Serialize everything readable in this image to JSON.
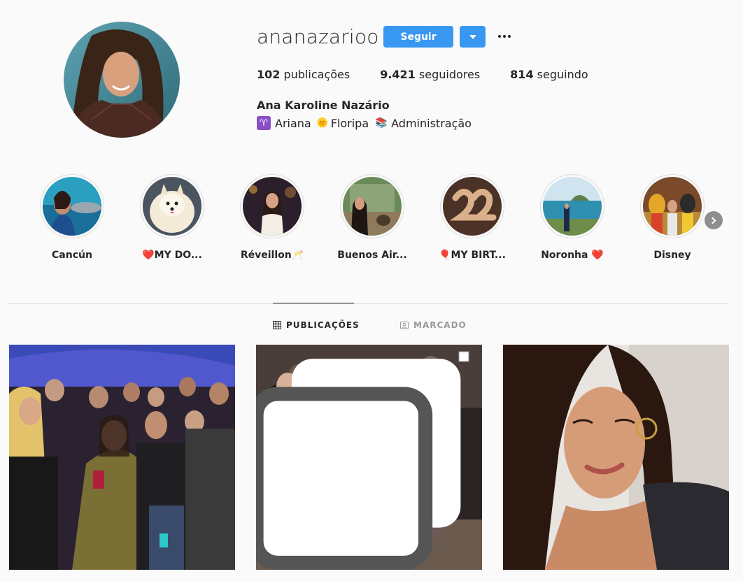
{
  "profile": {
    "username": "ananazarioo",
    "follow_label": "Seguir",
    "posts_count": "102",
    "posts_label": " publicações",
    "followers_count": "9.421",
    "followers_label": " seguidores",
    "following_count": "814",
    "following_label": " seguindo",
    "full_name": "Ana Karoline Nazário",
    "bio": {
      "part1": "Ariana",
      "part2": "Floripa",
      "part3": "Administração",
      "emoji1": "♈",
      "emoji2": "🌞",
      "emoji3": "📚"
    }
  },
  "highlights": [
    {
      "label": "Cancún"
    },
    {
      "label": "MY DO...",
      "prefix": "❤️"
    },
    {
      "label": "Réveillon",
      "suffix": "🥂"
    },
    {
      "label": "Buenos Air..."
    },
    {
      "label": "MY BIRT...",
      "prefix": "🎈"
    },
    {
      "label": "Noronha",
      "suffix": "❤️"
    },
    {
      "label": "Disney"
    }
  ],
  "tabs": {
    "posts": "PUBLICAÇÕES",
    "tagged": "MARCADO"
  },
  "colors": {
    "accent": "#3897f0",
    "text": "#262626",
    "muted": "#999999",
    "border": "#dbdbdb",
    "background": "#fafafa"
  },
  "icons": [
    "more-icon",
    "dropdown-arrow-icon",
    "grid-icon",
    "tagged-icon",
    "chevron-right-icon",
    "multiple-photos-icon"
  ]
}
